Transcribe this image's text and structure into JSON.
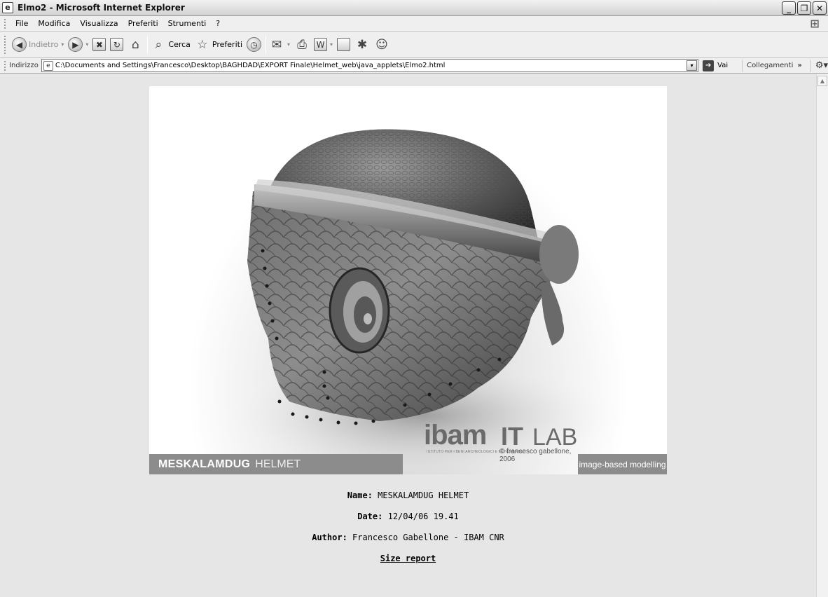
{
  "window": {
    "title": "Elmo2 - Microsoft Internet Explorer",
    "buttons": [
      "minimize",
      "restore",
      "close"
    ]
  },
  "menu": {
    "items": [
      "File",
      "Modifica",
      "Visualizza",
      "Preferiti",
      "Strumenti",
      "?"
    ]
  },
  "toolbar": {
    "back_label": "Indietro",
    "search_label": "Cerca",
    "favorites_label": "Preferiti",
    "icons": [
      "back-icon",
      "forward-icon",
      "stop-icon",
      "refresh-icon",
      "home-icon",
      "search-icon",
      "favorites-icon",
      "history-icon",
      "mail-icon",
      "print-icon",
      "edit-icon",
      "discuss-icon",
      "messenger-icon",
      "contacts-icon"
    ]
  },
  "address": {
    "label": "Indirizzo",
    "url": "C:\\Documents and Settings\\Francesco\\Desktop\\BAGHDAD\\EXPORT Finale\\Helmet_web\\java_applets\\Elmo2.html",
    "go_label": "Vai",
    "links_label": "Collegamenti",
    "links_chevron": "»"
  },
  "viewer": {
    "caption_main": "MESKALAMDUG",
    "caption_secondary": "HELMET",
    "logo_text": "ibam",
    "logo_it": "IT",
    "logo_lab": "LAB",
    "logo_subtitle": "ISTITUTO PER I BENI ARCHEOLOGICI E MONUMENTALI",
    "copyright": "© francesco gabellone, 2006",
    "tagline": "image-based modelling"
  },
  "info": {
    "name_label": "Name:",
    "name_value": "MESKALAMDUG HELMET",
    "date_label": "Date:",
    "date_value": "12/04/06 19.41",
    "author_label": "Author:",
    "author_value": "Francesco Gabellone - IBAM CNR",
    "size_report_link": "Size report"
  }
}
